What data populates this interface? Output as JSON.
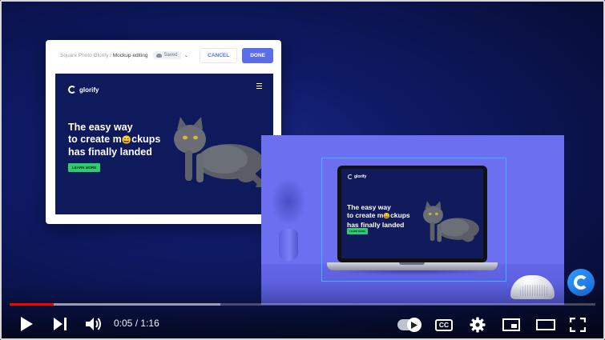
{
  "editor": {
    "breadcrumb_project": "Square Photo Glorify /",
    "breadcrumb_current": "Mockup editing",
    "saved_label": "Saved",
    "cancel_label": "CANCEL",
    "done_label": "DONE"
  },
  "design": {
    "brand_name": "glorify",
    "headline_1": "The easy way",
    "headline_2": "to create m",
    "headline_2_emoji": "😄",
    "headline_2_rest": "ckups",
    "headline_3": "has finally landed",
    "cta_label": "LEARN MORE"
  },
  "player": {
    "current_time": "0:05",
    "separator": "/",
    "duration": "1:16",
    "played_fraction": 0.075,
    "buffered_fraction": 0.36,
    "progress_color": "#ff0000",
    "icons": [
      "play-icon",
      "next-icon",
      "volume-icon",
      "autoplay-toggle-icon",
      "cc-icon",
      "settings-icon",
      "miniplayer-icon",
      "theater-icon",
      "fullscreen-icon"
    ],
    "cc_label": "CC"
  },
  "colors": {
    "accent": "#5b6ee8",
    "cta_green": "#2ecc71",
    "scene_purple": "#6c6ff0"
  }
}
